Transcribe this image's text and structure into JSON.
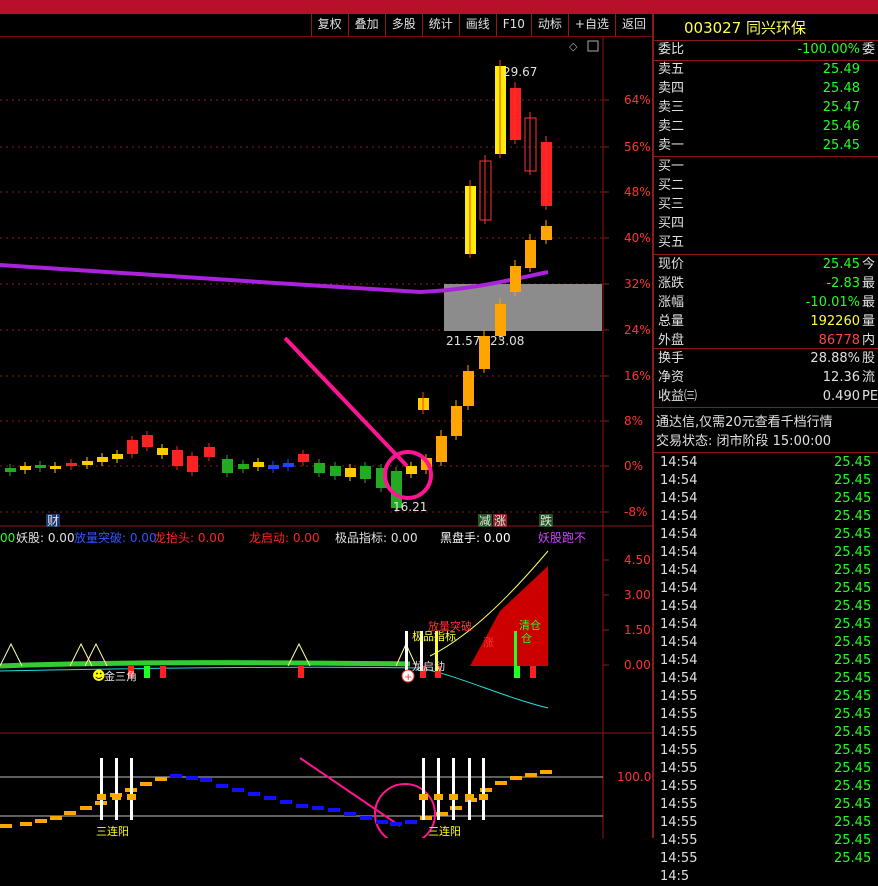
{
  "toolbar": [
    "复权",
    "叠加",
    "多股",
    "统计",
    "画线",
    "F10",
    "动标",
    "+自选",
    "返回"
  ],
  "stock": {
    "code_name": "003027 同兴环保"
  },
  "quote": {
    "weibi": {
      "label": "委比",
      "value": "-100.00%",
      "extra": "委"
    },
    "asks": [
      {
        "label": "卖五",
        "price": "25.49"
      },
      {
        "label": "卖四",
        "price": "25.48"
      },
      {
        "label": "卖三",
        "price": "25.47"
      },
      {
        "label": "卖二",
        "price": "25.46"
      },
      {
        "label": "卖一",
        "price": "25.45"
      }
    ],
    "bids": [
      {
        "label": "买一"
      },
      {
        "label": "买二"
      },
      {
        "label": "买三"
      },
      {
        "label": "买四"
      },
      {
        "label": "买五"
      }
    ],
    "stats": [
      {
        "label": "现价",
        "value": "25.45",
        "extra": "今",
        "color": "#22ff22"
      },
      {
        "label": "涨跌",
        "value": "-2.83",
        "extra": "最",
        "color": "#22ff22"
      },
      {
        "label": "涨幅",
        "value": "-10.01%",
        "extra": "最",
        "color": "#22ff22"
      },
      {
        "label": "总量",
        "value": "192260",
        "extra": "量",
        "color": "#ffff33"
      },
      {
        "label": "外盘",
        "value": "86778",
        "extra": "内",
        "color": "#ff4444"
      }
    ],
    "stats2": [
      {
        "label": "换手",
        "value": "28.88%",
        "extra": "股"
      },
      {
        "label": "净资",
        "value": "12.36",
        "extra": "流"
      },
      {
        "label": "收益㈢",
        "value": "0.490",
        "extra": "PE"
      }
    ],
    "notice": "通达信,仅需20元查看千档行情",
    "trade_status": "交易状态: 闭市阶段 15:00:00",
    "ticks": [
      {
        "t": "14:54",
        "p": "25.45"
      },
      {
        "t": "14:54",
        "p": "25.45"
      },
      {
        "t": "14:54",
        "p": "25.45"
      },
      {
        "t": "14:54",
        "p": "25.45"
      },
      {
        "t": "14:54",
        "p": "25.45"
      },
      {
        "t": "14:54",
        "p": "25.45"
      },
      {
        "t": "14:54",
        "p": "25.45"
      },
      {
        "t": "14:54",
        "p": "25.45"
      },
      {
        "t": "14:54",
        "p": "25.45"
      },
      {
        "t": "14:54",
        "p": "25.45"
      },
      {
        "t": "14:54",
        "p": "25.45"
      },
      {
        "t": "14:54",
        "p": "25.45"
      },
      {
        "t": "14:54",
        "p": "25.45"
      },
      {
        "t": "14:55",
        "p": "25.45"
      },
      {
        "t": "14:55",
        "p": "25.45"
      },
      {
        "t": "14:55",
        "p": "25.45"
      },
      {
        "t": "14:55",
        "p": "25.45"
      },
      {
        "t": "14:55",
        "p": "25.45"
      },
      {
        "t": "14:55",
        "p": "25.45"
      },
      {
        "t": "14:55",
        "p": "25.45"
      },
      {
        "t": "14:55",
        "p": "25.45"
      },
      {
        "t": "14:55",
        "p": "25.45"
      },
      {
        "t": "14:55",
        "p": "25.45"
      },
      {
        "t": "14:5",
        "p": ""
      }
    ]
  },
  "chart": {
    "pct_ticks": [
      "64%",
      "56%",
      "48%",
      "40%",
      "32%",
      "24%",
      "16%",
      "8%",
      "0%",
      "-8%"
    ],
    "annotations": {
      "high": "29.67",
      "low": "16.21",
      "gap_low": "21.57",
      "gap_high": "23.08"
    },
    "markers": {
      "cai": "财",
      "jian": "减",
      "zhang": "涨",
      "die": "跌"
    },
    "indicator_header": [
      {
        "text": "00",
        "color": "#22ff22"
      },
      {
        "text": "妖股: 0.00",
        "color": "#e0e0e0"
      },
      {
        "text": "放量突破: 0.00",
        "color": "#3355ff"
      },
      {
        "text": "龙抬头: 0.00",
        "color": "#ff2222"
      },
      {
        "text": "龙启动: 0.00",
        "color": "#ff2222"
      },
      {
        "text": "极品指标: 0.00",
        "color": "#e0e0e0"
      },
      {
        "text": "黑盘手: 0.00",
        "color": "#ffffff"
      },
      {
        "text": "妖股跑不",
        "color": "#cc44ff"
      }
    ],
    "ind_ticks": [
      "4.50",
      "3.00",
      "1.50",
      "0.00"
    ],
    "ind_labels": {
      "san": "金三角",
      "qing": "清仓",
      "fang": "放量突破",
      "ji": "极品指标",
      "long": "龙启动",
      "zhang": "涨",
      "cang": "仓"
    },
    "bottom_tick": "100.0",
    "bottom_text": "三连阳"
  }
}
